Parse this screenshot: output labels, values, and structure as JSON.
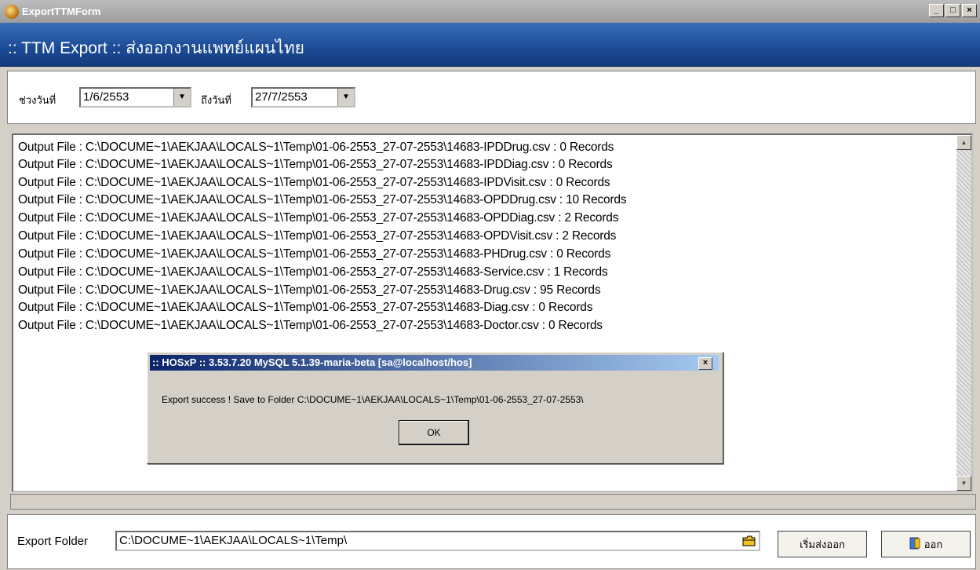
{
  "window": {
    "title": "ExportTTMForm",
    "minimize": "_",
    "maximize": "□",
    "close": "×"
  },
  "banner": {
    "title": ":: TTM Export  :: ส่งออกงานแพทย์แผนไทย"
  },
  "date_range": {
    "from_label": "ช่วงวันที่",
    "from_value": "1/6/2553",
    "to_label": "ถึงวันที่",
    "to_value": "27/7/2553"
  },
  "log": [
    "Output File : C:\\DOCUME~1\\AEKJAA\\LOCALS~1\\Temp\\01-06-2553_27-07-2553\\14683-IPDDrug.csv : 0 Records",
    "Output File : C:\\DOCUME~1\\AEKJAA\\LOCALS~1\\Temp\\01-06-2553_27-07-2553\\14683-IPDDiag.csv : 0 Records",
    "Output File : C:\\DOCUME~1\\AEKJAA\\LOCALS~1\\Temp\\01-06-2553_27-07-2553\\14683-IPDVisit.csv : 0 Records",
    "Output File : C:\\DOCUME~1\\AEKJAA\\LOCALS~1\\Temp\\01-06-2553_27-07-2553\\14683-OPDDrug.csv : 10 Records",
    "Output File : C:\\DOCUME~1\\AEKJAA\\LOCALS~1\\Temp\\01-06-2553_27-07-2553\\14683-OPDDiag.csv : 2 Records",
    "Output File : C:\\DOCUME~1\\AEKJAA\\LOCALS~1\\Temp\\01-06-2553_27-07-2553\\14683-OPDVisit.csv : 2 Records",
    "Output File : C:\\DOCUME~1\\AEKJAA\\LOCALS~1\\Temp\\01-06-2553_27-07-2553\\14683-PHDrug.csv : 0 Records",
    "Output File : C:\\DOCUME~1\\AEKJAA\\LOCALS~1\\Temp\\01-06-2553_27-07-2553\\14683-Service.csv : 1 Records",
    "Output File : C:\\DOCUME~1\\AEKJAA\\LOCALS~1\\Temp\\01-06-2553_27-07-2553\\14683-Drug.csv : 95 Records",
    "Output File : C:\\DOCUME~1\\AEKJAA\\LOCALS~1\\Temp\\01-06-2553_27-07-2553\\14683-Diag.csv : 0 Records",
    "Output File : C:\\DOCUME~1\\AEKJAA\\LOCALS~1\\Temp\\01-06-2553_27-07-2553\\14683-Doctor.csv : 0 Records"
  ],
  "dialog": {
    "title": ":: HOSxP :: 3.53.7.20 MySQL 5.1.39-maria-beta [sa@localhost/hos]",
    "message": "Export success ! Save to Folder C:\\DOCUME~1\\AEKJAA\\LOCALS~1\\Temp\\01-06-2553_27-07-2553\\",
    "ok_label": "OK",
    "close": "×"
  },
  "export": {
    "folder_label": "Export Folder",
    "folder_value": "C:\\DOCUME~1\\AEKJAA\\LOCALS~1\\Temp\\",
    "start_label": "เริ่มส่งออก",
    "exit_label": "ออก"
  },
  "colors": {
    "banner": "#1b4a95",
    "dialog_title": "#0a246a"
  },
  "icons": [
    "app-icon",
    "dropdown-arrow-icon",
    "folder-icon",
    "exit-door-icon",
    "scroll-up-icon",
    "scroll-down-icon"
  ]
}
